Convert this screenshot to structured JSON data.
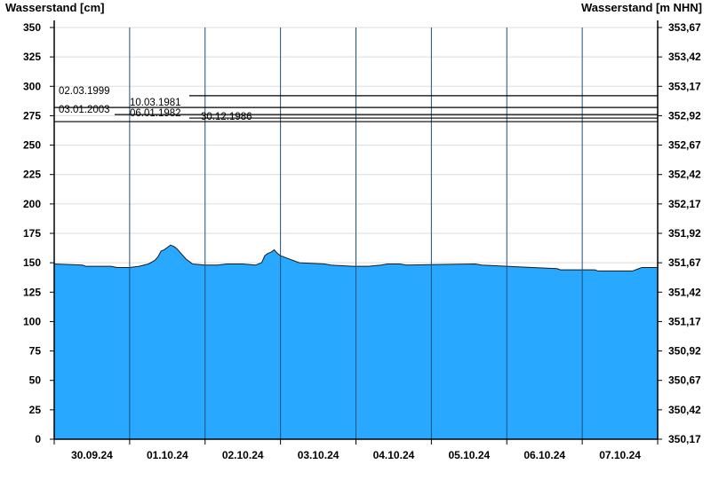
{
  "chart_data": {
    "type": "area",
    "ylabel_left": "Wasserstand [cm]",
    "ylabel_right": "Wasserstand [m NHN]",
    "ylim": [
      0,
      350
    ],
    "yticks_left": [
      0,
      25,
      50,
      75,
      100,
      125,
      150,
      175,
      200,
      225,
      250,
      275,
      300,
      325,
      350
    ],
    "yticks_right": [
      "350,17",
      "350,42",
      "350,67",
      "350,92",
      "351,17",
      "351,42",
      "351,67",
      "351,92",
      "352,17",
      "352,42",
      "352,67",
      "352,92",
      "353,17",
      "353,42",
      "353,67"
    ],
    "xticks": [
      "30.09.24",
      "01.10.24",
      "02.10.24",
      "03.10.24",
      "04.10.24",
      "05.10.24",
      "06.10.24",
      "07.10.24"
    ],
    "xlim_hours": [
      0,
      192
    ],
    "grid": true,
    "series": [
      {
        "color": "#29a8ff",
        "points": [
          [
            0,
            149
          ],
          [
            9,
            148
          ],
          [
            10,
            147
          ],
          [
            18,
            147
          ],
          [
            20,
            146
          ],
          [
            24,
            146
          ],
          [
            27,
            147
          ],
          [
            30,
            149
          ],
          [
            32,
            152
          ],
          [
            33,
            155
          ],
          [
            34,
            160
          ],
          [
            35,
            161
          ],
          [
            36,
            163
          ],
          [
            37,
            165
          ],
          [
            38,
            164
          ],
          [
            39,
            162
          ],
          [
            40,
            159
          ],
          [
            41,
            156
          ],
          [
            42,
            153
          ],
          [
            43,
            151
          ],
          [
            44,
            149
          ],
          [
            48,
            148
          ],
          [
            52,
            148
          ],
          [
            55,
            149
          ],
          [
            60,
            149
          ],
          [
            64,
            148
          ],
          [
            66,
            150
          ],
          [
            67,
            156
          ],
          [
            68,
            158
          ],
          [
            69,
            159
          ],
          [
            70,
            161
          ],
          [
            71,
            158
          ],
          [
            72,
            156
          ],
          [
            74,
            154
          ],
          [
            75,
            153
          ],
          [
            76,
            152
          ],
          [
            78,
            150
          ],
          [
            86,
            149
          ],
          [
            88,
            148
          ],
          [
            95,
            147
          ],
          [
            100,
            147
          ],
          [
            104,
            148
          ],
          [
            106,
            149
          ],
          [
            110,
            149
          ],
          [
            112,
            148
          ],
          [
            134,
            149
          ],
          [
            136,
            148
          ],
          [
            144,
            147
          ],
          [
            152,
            146
          ],
          [
            160,
            145
          ],
          [
            161,
            144
          ],
          [
            172,
            144
          ],
          [
            173,
            143
          ],
          [
            184,
            143
          ],
          [
            186,
            145
          ],
          [
            187,
            146
          ],
          [
            192,
            146
          ]
        ]
      }
    ],
    "annotations": [
      {
        "label": "02.03.1999",
        "value": 292
      },
      {
        "label": "10.03.1981",
        "value": 282
      },
      {
        "label": "03.01.2003",
        "value": 276
      },
      {
        "label": "06.01.1982",
        "value": 273
      },
      {
        "label": "30.12.1986",
        "value": 270
      }
    ]
  }
}
